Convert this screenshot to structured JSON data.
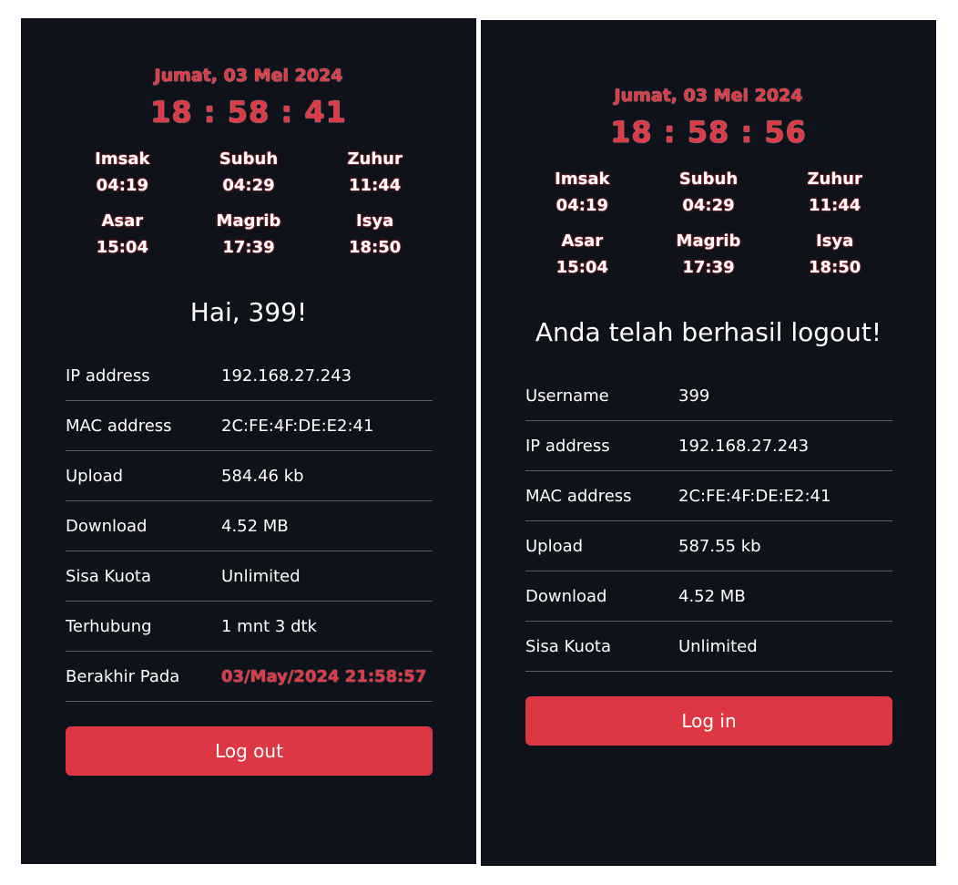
{
  "left": {
    "date": "Jumat, 03 Mei 2024",
    "time": "18 : 58 : 41",
    "prayers": [
      {
        "name": "Imsak",
        "time": "04:19"
      },
      {
        "name": "Subuh",
        "time": "04:29"
      },
      {
        "name": "Zuhur",
        "time": "11:44"
      },
      {
        "name": "Asar",
        "time": "15:04"
      },
      {
        "name": "Magrib",
        "time": "17:39"
      },
      {
        "name": "Isya",
        "time": "18:50"
      }
    ],
    "greeting": "Hai, 399!",
    "rows": [
      {
        "label": "IP address",
        "value": "192.168.27.243"
      },
      {
        "label": "MAC address",
        "value": "2C:FE:4F:DE:E2:41"
      },
      {
        "label": "Upload",
        "value": "584.46 kb"
      },
      {
        "label": "Download",
        "value": "4.52 MB"
      },
      {
        "label": "Sisa Kuota",
        "value": "Unlimited"
      },
      {
        "label": "Terhubung",
        "value": "1 mnt 3 dtk"
      },
      {
        "label": "Berakhir Pada",
        "value": "03/May/2024 21:58:57"
      }
    ],
    "button": "Log out"
  },
  "right": {
    "date": "Jumat, 03 Mei 2024",
    "time": "18 : 58 : 56",
    "prayers": [
      {
        "name": "Imsak",
        "time": "04:19"
      },
      {
        "name": "Subuh",
        "time": "04:29"
      },
      {
        "name": "Zuhur",
        "time": "11:44"
      },
      {
        "name": "Asar",
        "time": "15:04"
      },
      {
        "name": "Magrib",
        "time": "17:39"
      },
      {
        "name": "Isya",
        "time": "18:50"
      }
    ],
    "message": "Anda telah berhasil logout!",
    "rows": [
      {
        "label": "Username",
        "value": "399"
      },
      {
        "label": "IP address",
        "value": "192.168.27.243"
      },
      {
        "label": "MAC address",
        "value": "2C:FE:4F:DE:E2:41"
      },
      {
        "label": "Upload",
        "value": "587.55 kb"
      },
      {
        "label": "Download",
        "value": "4.52 MB"
      },
      {
        "label": "Sisa Kuota",
        "value": "Unlimited"
      }
    ],
    "button": "Log in"
  },
  "colors": {
    "panel_bg": "#0f121b",
    "accent_red": "#dc3742",
    "divider": "#5a5e67"
  }
}
